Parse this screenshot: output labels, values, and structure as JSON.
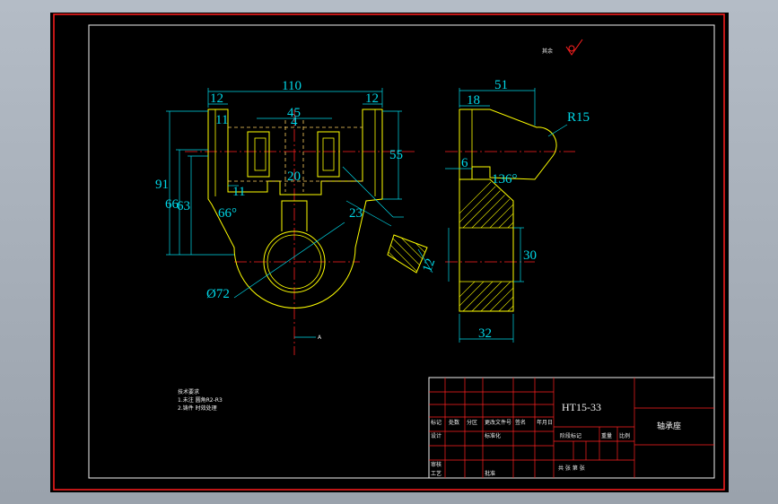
{
  "drawing": {
    "colors": {
      "background": "#000000",
      "outer_frame": "#ff1e1e",
      "inner_frame": "#f0f0f0",
      "outline": "#ffff00",
      "dimension": "#00d8e8",
      "centerline": "#ff2020",
      "hidden": "#ffd060",
      "text": "#f0f0f0"
    },
    "front_view": {
      "dim_overall_width": "110",
      "dim_left_lug": "12",
      "dim_right_lug": "12",
      "dim_top_small": "11",
      "dim_slot": "45",
      "dim_slot_inner": "4",
      "dim_keyway": "20",
      "dim_overall_height": "91",
      "dim_height_66": "66",
      "dim_height_63": "63",
      "dim_right_height": "55",
      "dim_small_11": "11",
      "dim_angle": "66°",
      "dim_bore_dia": "Ø72",
      "dim_r23": "23",
      "section_label": "A"
    },
    "side_view": {
      "dim_total_width": "51",
      "dim_flange": "18",
      "dim_radius": "R15",
      "dim_step": "6",
      "dim_angle": "136°",
      "dim_height": "30",
      "dim_base": "32"
    },
    "detail_view": {
      "dim_thickness": "12"
    },
    "roughness_note": "其余",
    "tech_notes": [
      "技术要求",
      "1.未注  圆角R2-R3",
      "2.铸件  时效处理"
    ]
  },
  "title_block": {
    "material": "HT15-33",
    "part_name": "轴承座",
    "labels": [
      "标记",
      "处数",
      "分区",
      "更改文件号",
      "签名",
      "年月日",
      "设计",
      "标准化",
      "审核",
      "工艺",
      "批准",
      "阶段标记",
      "重量",
      "比例",
      "共 张 第 张"
    ]
  }
}
